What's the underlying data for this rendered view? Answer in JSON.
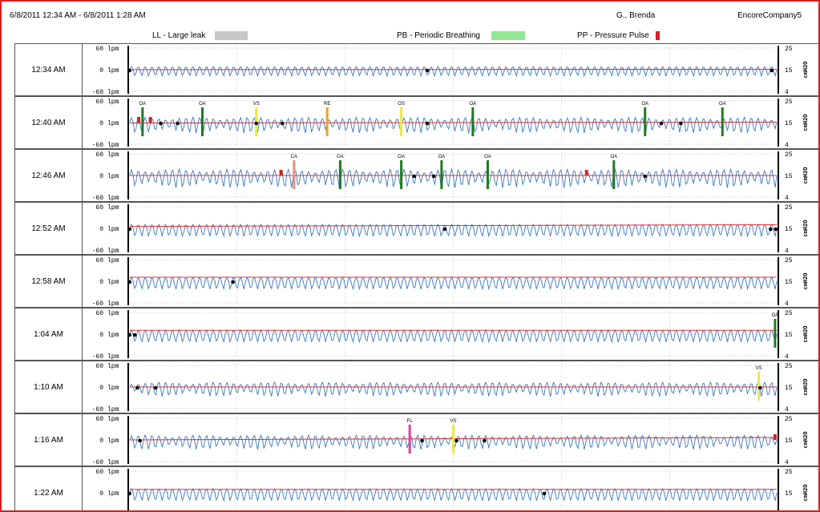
{
  "header": {
    "date_range": "6/8/2011  12:34 AM - 6/8/2011  1:28 AM",
    "patient": "G., Brenda",
    "company": "EncoreCompany5"
  },
  "legend": [
    {
      "label": "LL - Large leak",
      "color": "#c8c8c8"
    },
    {
      "label": "PB - Periodic Breathing",
      "color": "#90e890"
    },
    {
      "label": "PP - Pressure Pulse",
      "color": "#d42020"
    }
  ],
  "axes": {
    "left_ticks": [
      "60",
      "0",
      "-60"
    ],
    "left_units": [
      "lpm",
      "lpm",
      "lpm"
    ],
    "right_ticks": [
      "25",
      "15",
      "4"
    ],
    "right_unit": "cmH2O"
  },
  "colors": {
    "flow": "#3a78c0",
    "pressure": "#e03030",
    "OA": "#1e7a1e",
    "CA": "#f09070",
    "VS": "#ece840",
    "RE": "#f0a030",
    "FL": "#e040a0",
    "PP": "#d42020",
    "frame": "#d42020"
  },
  "rows": [
    {
      "time": "12:34 AM",
      "amp": 0.35,
      "irregular": false,
      "pressure_start": 0.0,
      "pressure_end": 0.05,
      "events": [],
      "dots": [
        0.002,
        0.46,
        0.99
      ],
      "pp": []
    },
    {
      "time": "12:40 AM",
      "amp": 0.55,
      "irregular": true,
      "pressure_start": -0.05,
      "pressure_end": 0.05,
      "events": [
        {
          "type": "OA",
          "label": "OA",
          "pos": 0.022
        },
        {
          "type": "OA",
          "label": "OA",
          "pos": 0.114
        },
        {
          "type": "VS",
          "label": "VS",
          "pos": 0.197
        },
        {
          "type": "RE",
          "label": "RE",
          "pos": 0.306
        },
        {
          "type": "VS",
          "label": "OS",
          "pos": 0.42
        },
        {
          "type": "OA",
          "label": "OA",
          "pos": 0.53
        },
        {
          "type": "OA",
          "label": "OA",
          "pos": 0.795
        },
        {
          "type": "OA",
          "label": "OA",
          "pos": 0.914
        }
      ],
      "dots": [
        0.05,
        0.076,
        0.197,
        0.237,
        0.46,
        0.82,
        0.85
      ],
      "pp": [
        0.016,
        0.034
      ]
    },
    {
      "time": "12:46 AM",
      "amp": 0.65,
      "irregular": true,
      "pressure_start": 0.0,
      "pressure_end": 0.0,
      "events": [
        {
          "type": "CA",
          "label": "CA",
          "pos": 0.255
        },
        {
          "type": "OA",
          "label": "OA",
          "pos": 0.326
        },
        {
          "type": "OA",
          "label": "OA",
          "pos": 0.42
        },
        {
          "type": "OA",
          "label": "OA",
          "pos": 0.482
        },
        {
          "type": "OA",
          "label": "OA",
          "pos": 0.553
        },
        {
          "type": "OA",
          "label": "OA",
          "pos": 0.747
        }
      ],
      "dots": [
        0.44,
        0.47,
        0.795
      ],
      "pp": [
        0.235,
        0.705
      ]
    },
    {
      "time": "12:52 AM",
      "amp": 0.45,
      "irregular": false,
      "pressure_start": 0.2,
      "pressure_end": 0.38,
      "events": [],
      "dots": [
        0.002,
        0.487,
        0.988,
        0.996
      ],
      "pp": []
    },
    {
      "time": "12:58 AM",
      "amp": 0.45,
      "irregular": false,
      "pressure_start": 0.42,
      "pressure_end": 0.42,
      "events": [],
      "dots": [
        0.002,
        0.161
      ],
      "pp": []
    },
    {
      "time": "1:04 AM",
      "amp": 0.45,
      "irregular": false,
      "pressure_start": 0.4,
      "pressure_end": 0.4,
      "events": [
        {
          "type": "OA",
          "label": "OA",
          "pos": 0.995
        }
      ],
      "dots": [
        0.002,
        0.01
      ],
      "pp": []
    },
    {
      "time": "1:10 AM",
      "amp": 0.5,
      "irregular": true,
      "pressure_start": 0.0,
      "pressure_end": 0.0,
      "events": [
        {
          "type": "VS",
          "label": "VS",
          "pos": 0.97
        }
      ],
      "dots": [
        0.014,
        0.042,
        0.972
      ],
      "pp": []
    },
    {
      "time": "1:16 AM",
      "amp": 0.5,
      "irregular": true,
      "pressure_start": 0.0,
      "pressure_end": 0.25,
      "events": [
        {
          "type": "FL",
          "label": "FL",
          "pos": 0.433
        },
        {
          "type": "VS",
          "label": "VS",
          "pos": 0.5
        }
      ],
      "dots": [
        0.018,
        0.452,
        0.505,
        0.548
      ],
      "pp": [
        0.995
      ]
    },
    {
      "time": "1:22 AM",
      "amp": 0.45,
      "irregular": false,
      "pressure_start": 0.35,
      "pressure_end": 0.35,
      "events": [],
      "dots": [
        0.002,
        0.64
      ],
      "pp": []
    }
  ]
}
